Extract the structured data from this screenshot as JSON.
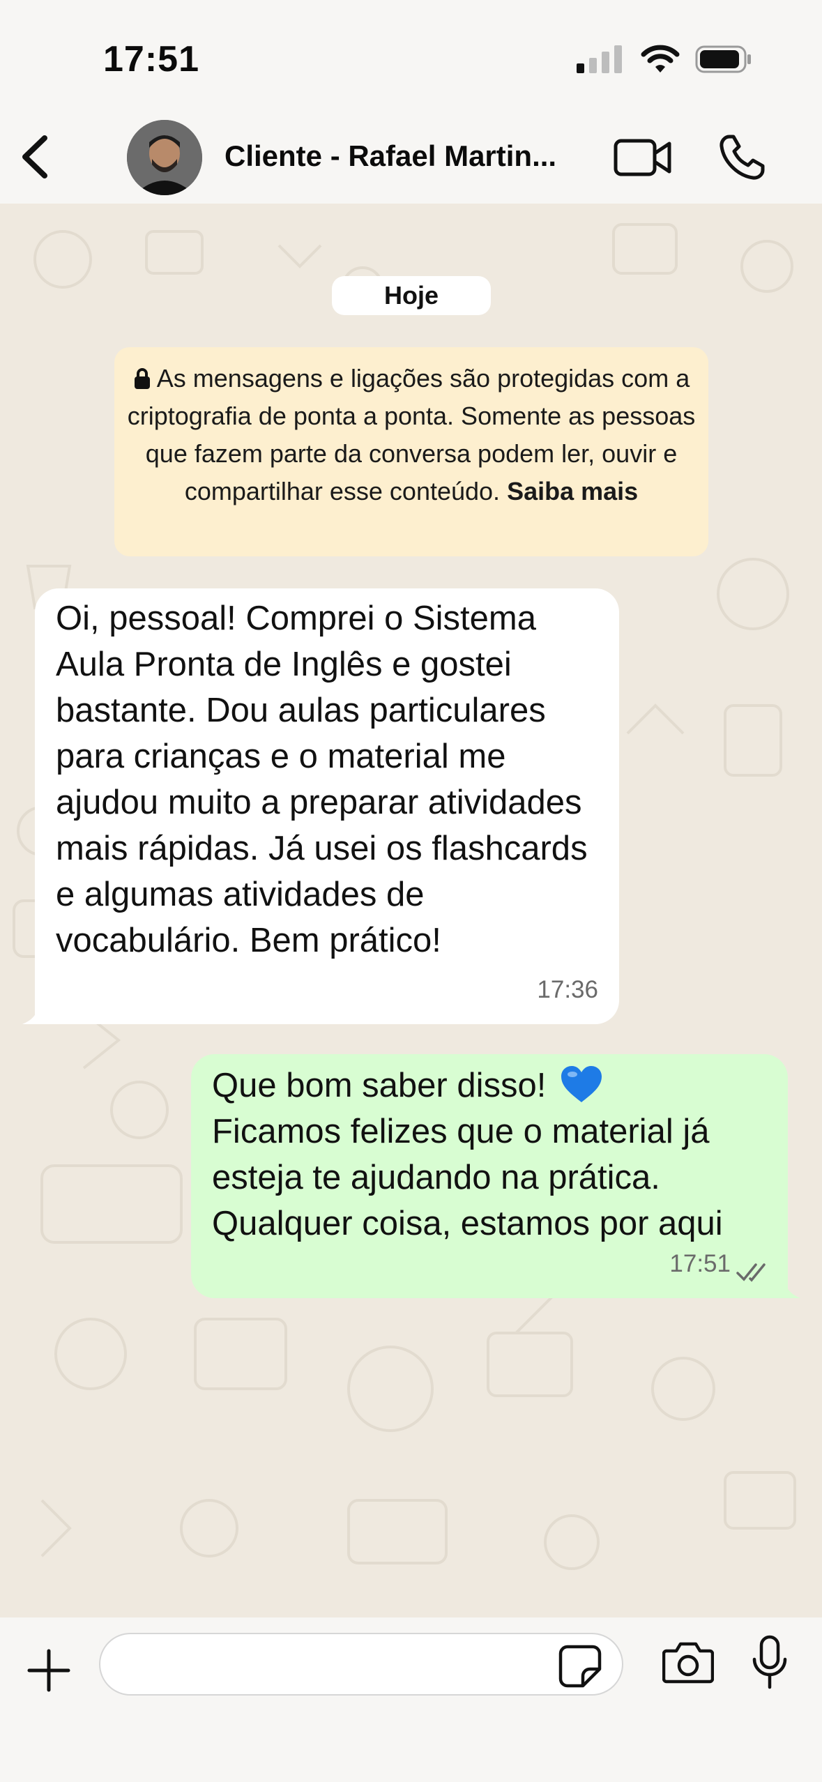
{
  "status_bar": {
    "time": "17:51"
  },
  "header": {
    "contact_name": "Cliente - Rafael Martin...",
    "icons": [
      "back-chevron-icon",
      "video-camera-icon",
      "phone-icon"
    ]
  },
  "chat": {
    "date_label": "Hoje",
    "encryption_notice": {
      "text": "As mensagens e ligações são protegidas com a criptografia de ponta a ponta. Somente as pessoas que fazem parte da conversa podem ler, ouvir e compartilhar esse conteúdo.",
      "link": "Saiba mais"
    },
    "messages": [
      {
        "direction": "incoming",
        "text": "Oi, pessoal! Comprei o Sistema Aula Pronta de Inglês e gostei bastante. Dou aulas particulares para crianças e o material me ajudou muito a preparar atividades mais rápidas. Já usei os flashcards e algumas atividades de vocabulário. Bem prático!",
        "time": "17:36"
      },
      {
        "direction": "outgoing",
        "text": "Que bom saber disso!",
        "text_rest": "Ficamos felizes que o material já esteja te ajudando na prática. Qualquer coisa, estamos por aqui",
        "emoji": "blue-heart",
        "time": "17:51",
        "status": "read"
      }
    ]
  },
  "composer": {
    "value": "",
    "placeholder": ""
  },
  "colors": {
    "incoming_bubble": "#ffffff",
    "outgoing_bubble": "#d8fdd2",
    "encryption_notice_bg": "#fdefcf",
    "chat_background": "#efe9df"
  }
}
